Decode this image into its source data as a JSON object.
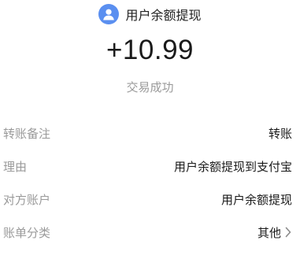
{
  "header": {
    "payer_name": "用户余额提现",
    "avatar_icon": "person-avatar-icon",
    "avatar_color": "#5a8ff0"
  },
  "transaction": {
    "amount": "+10.99",
    "status": "交易成功"
  },
  "details": [
    {
      "label": "转账备注",
      "value": "转账"
    },
    {
      "label": "理由",
      "value": "用户余额提现到支付宝"
    },
    {
      "label": "对方账户",
      "value": "用户余额提现"
    },
    {
      "label": "账单分类",
      "value": "其他",
      "icon": "chevron-right-icon"
    }
  ]
}
